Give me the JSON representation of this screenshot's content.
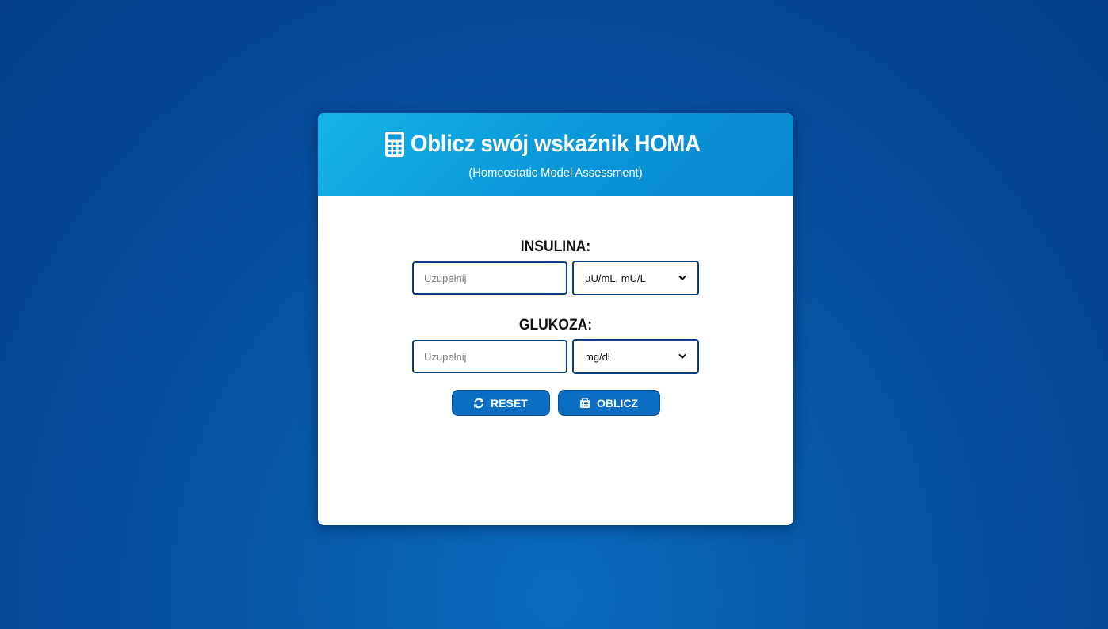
{
  "header": {
    "title": "Oblicz swój wskaźnik HOMA",
    "subtitle": "(Homeostatic Model Assessment)",
    "icon": "calculator-icon"
  },
  "insulin": {
    "label": "INSULINA:",
    "placeholder": "Uzupełnij",
    "value": "",
    "unit_selected": "µU/mL, mU/L"
  },
  "glucose": {
    "label": "GLUKOZA:",
    "placeholder": "Uzupełnij",
    "value": "",
    "unit_selected": "mg/dl"
  },
  "buttons": {
    "reset_label": "RESET",
    "reset_icon": "refresh-icon",
    "calculate_label": "OBLICZ",
    "calculate_icon": "calculator-icon"
  },
  "colors": {
    "header_gradient_start": "#14b4e6",
    "button_bg": "#0a6fc2",
    "input_border": "#0b3d7e",
    "page_bg": "#054a98"
  }
}
